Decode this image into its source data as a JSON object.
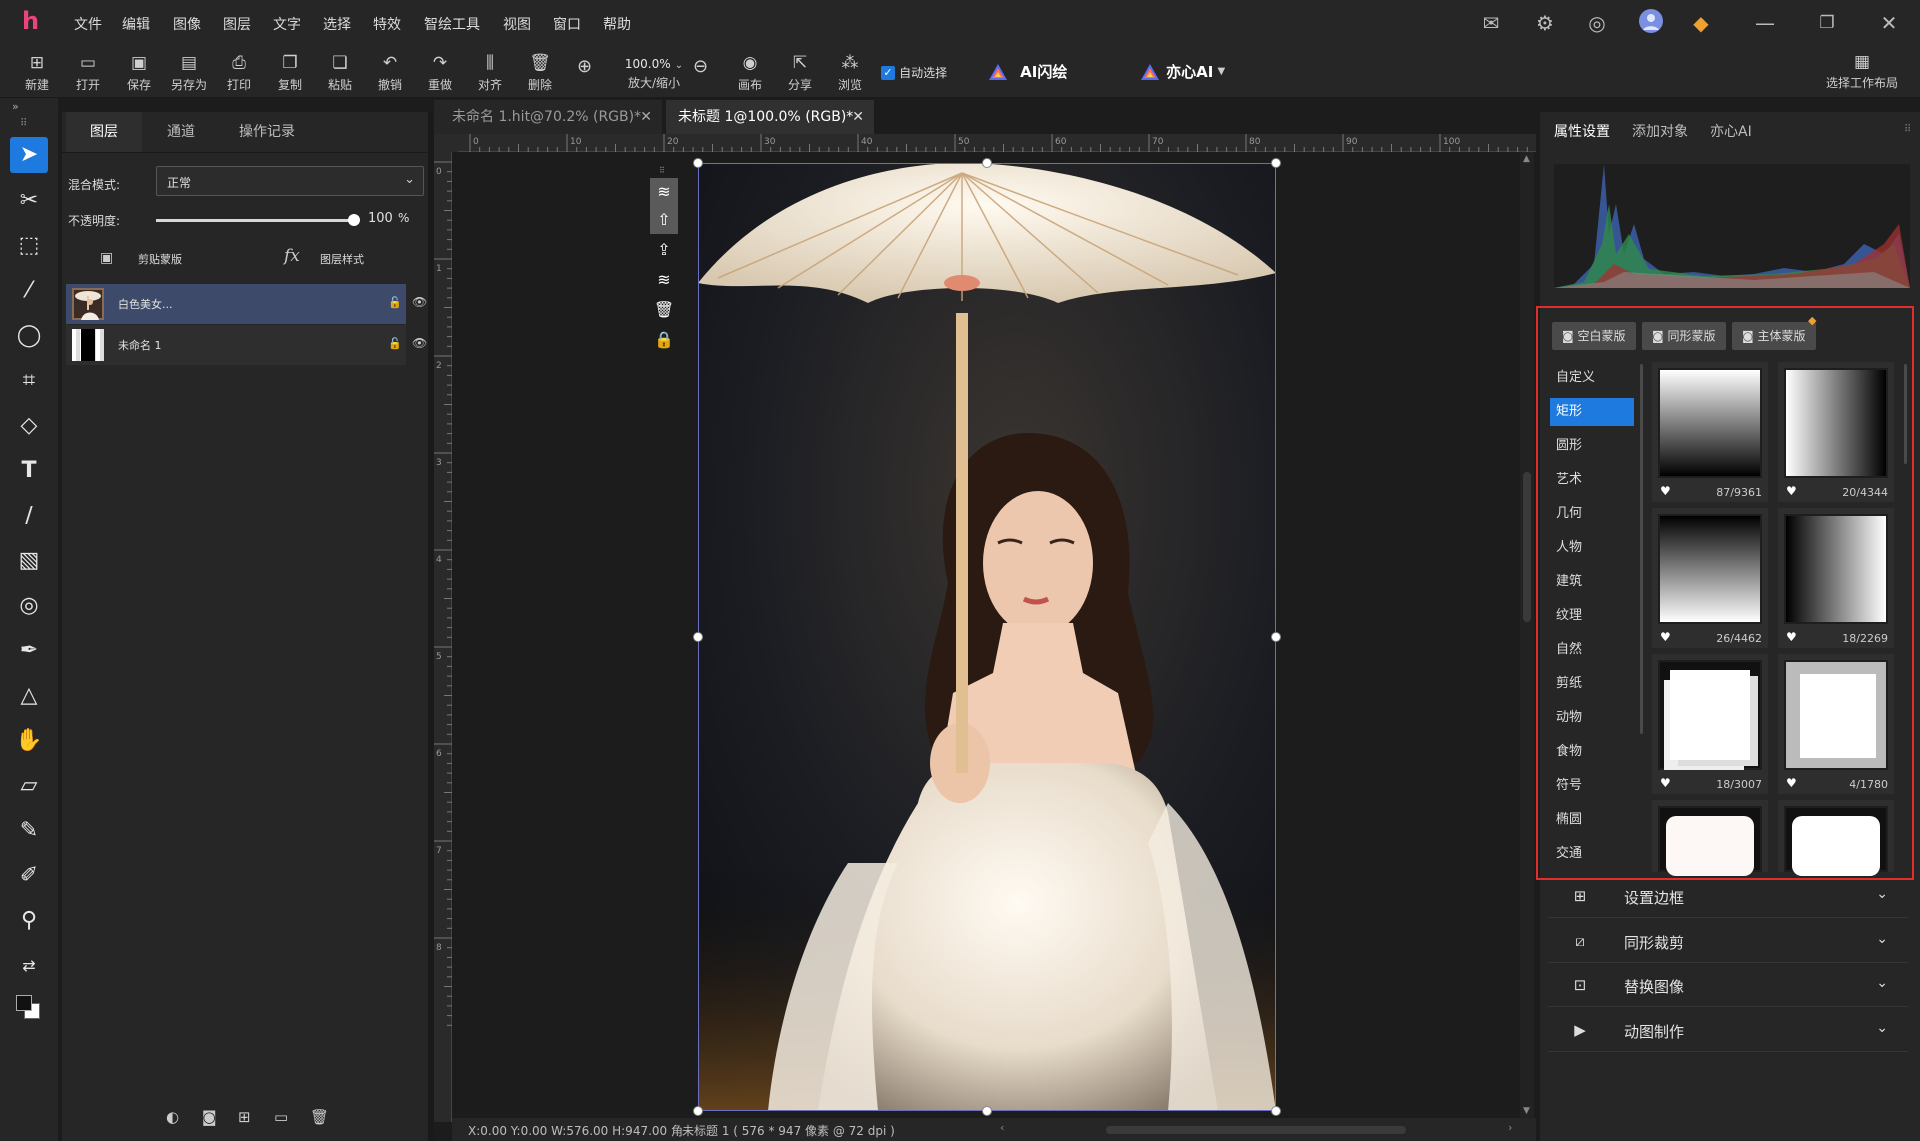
{
  "app": {
    "logo": "h"
  },
  "menu": [
    "文件",
    "编辑",
    "图像",
    "图层",
    "文字",
    "选择",
    "特效",
    "智绘工具",
    "视图",
    "窗口",
    "帮助"
  ],
  "toolbar": {
    "buttons": [
      "新建",
      "打开",
      "保存",
      "另存为",
      "打印",
      "复制",
      "粘贴",
      "撤销",
      "重做",
      "对齐",
      "删除"
    ],
    "zoom_value": "100.0%",
    "zoom_label": "放大/缩小",
    "canvas_label": "画布",
    "share_label": "分享",
    "browse_label": "浏览",
    "auto_select": "自动选择",
    "ai_flash": "AI闪绘",
    "yixin_ai": "亦心AI",
    "workspace": "选择工作布局"
  },
  "tools": [
    "move-tool",
    "cutout-tool",
    "marquee-tool",
    "magic-wand-tool",
    "lasso-tool",
    "crop-tool",
    "fill-tool",
    "text-tool",
    "brush-tool",
    "pattern-tool",
    "clone-tool",
    "pen-tool",
    "shape-tool",
    "hand-tool",
    "transform-tool",
    "heal-tool",
    "eraser-tool",
    "eyedropper-tool",
    "swap-colors-tool",
    "color-swatch"
  ],
  "layers_panel": {
    "tabs": [
      "图层",
      "通道",
      "操作记录"
    ],
    "blend_label": "混合模式:",
    "blend_value": "正常",
    "opacity_label": "不透明度:",
    "opacity_value": "100",
    "opacity_unit": "%",
    "opacity": 1.0,
    "clip_mask": "剪贴蒙版",
    "fx": "fx",
    "layer_style": "图层样式",
    "layers": [
      {
        "name": "白色美女...",
        "selected": true
      },
      {
        "name": "未命名 1",
        "selected": false
      }
    ]
  },
  "documents": {
    "tabs": [
      "未命名 1.hit@70.2% (RGB)*",
      "未标题 1@100.0% (RGB)*"
    ],
    "active": 1
  },
  "ruler": {
    "h_labels": [
      "0",
      "10",
      "20",
      "30",
      "40",
      "50",
      "60",
      "70",
      "80",
      "90",
      "100"
    ],
    "v_labels": [
      "0",
      "1",
      "2",
      "3",
      "4",
      "5",
      "6",
      "7",
      "8"
    ]
  },
  "status": {
    "coords": "X:0.00 Y:0.00 W:576.00 H:947.00 角",
    "doc_info": "未标题 1 ( 576 * 947 像素 @ 72 dpi )"
  },
  "right_panel": {
    "tabs": [
      "属性设置",
      "添加对象",
      "亦心AI"
    ],
    "mask_buttons": [
      "空白蒙版",
      "同形蒙版",
      "主体蒙版"
    ],
    "categories": [
      "自定义",
      "矩形",
      "圆形",
      "艺术",
      "几何",
      "人物",
      "建筑",
      "纹理",
      "自然",
      "剪纸",
      "动物",
      "食物",
      "符号",
      "椭圆",
      "交通"
    ],
    "active_category": 1,
    "tiles": [
      "87/9361",
      "20/4344",
      "26/4462",
      "18/2269",
      "18/3007",
      "4/1780",
      "",
      ""
    ],
    "accordion": [
      "设置边框",
      "同形裁剪",
      "替换图像",
      "动图制作"
    ]
  },
  "colors": {
    "accent": "#1f7ae0",
    "highlight_border": "#e02d2d"
  }
}
